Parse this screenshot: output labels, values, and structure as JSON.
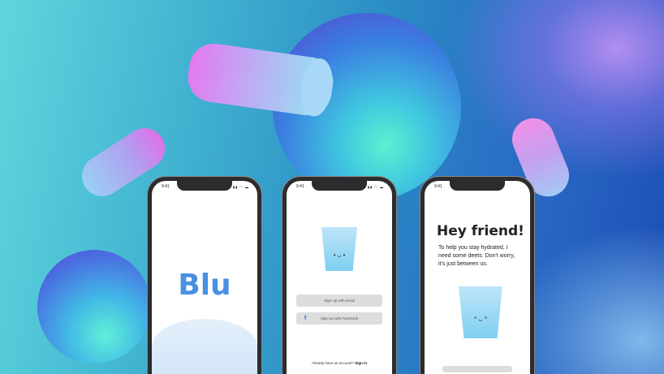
{
  "status_time": "9:41",
  "splash": {
    "logo": "Blu"
  },
  "signup": {
    "email_button": "Sign Up with email",
    "facebook_button": "Sign Up with Facebook",
    "facebook_icon": "f",
    "signin_prompt": "Already have an account?",
    "signin_link": "Sign in"
  },
  "onboarding": {
    "title": "Hey friend!",
    "body": "To help you stay hydrated, I need some deets. Don't worry, it's just between us."
  },
  "colors": {
    "accent": "#4a90e2",
    "facebook": "#1877f2"
  }
}
